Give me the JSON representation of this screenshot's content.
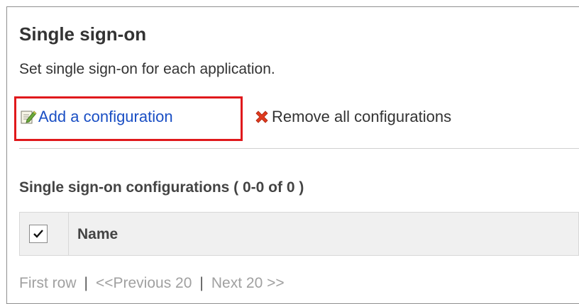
{
  "page": {
    "title": "Single sign-on",
    "description": "Set single sign-on for each application."
  },
  "toolbar": {
    "add_label": "Add a configuration",
    "add_icon": "edit-note-icon",
    "remove_label": "Remove all configurations",
    "remove_icon": "red-x-icon",
    "highlight_color": "#e0191c",
    "link_color": "#1a4fc4"
  },
  "list": {
    "section_title": "Single sign-on configurations ( 0-0 of 0 )",
    "columns": [
      "Name"
    ],
    "select_all_checked": true
  },
  "pager": {
    "first": "First row",
    "previous": "<<Previous 20",
    "next": "Next 20 >>",
    "separator": "|"
  }
}
